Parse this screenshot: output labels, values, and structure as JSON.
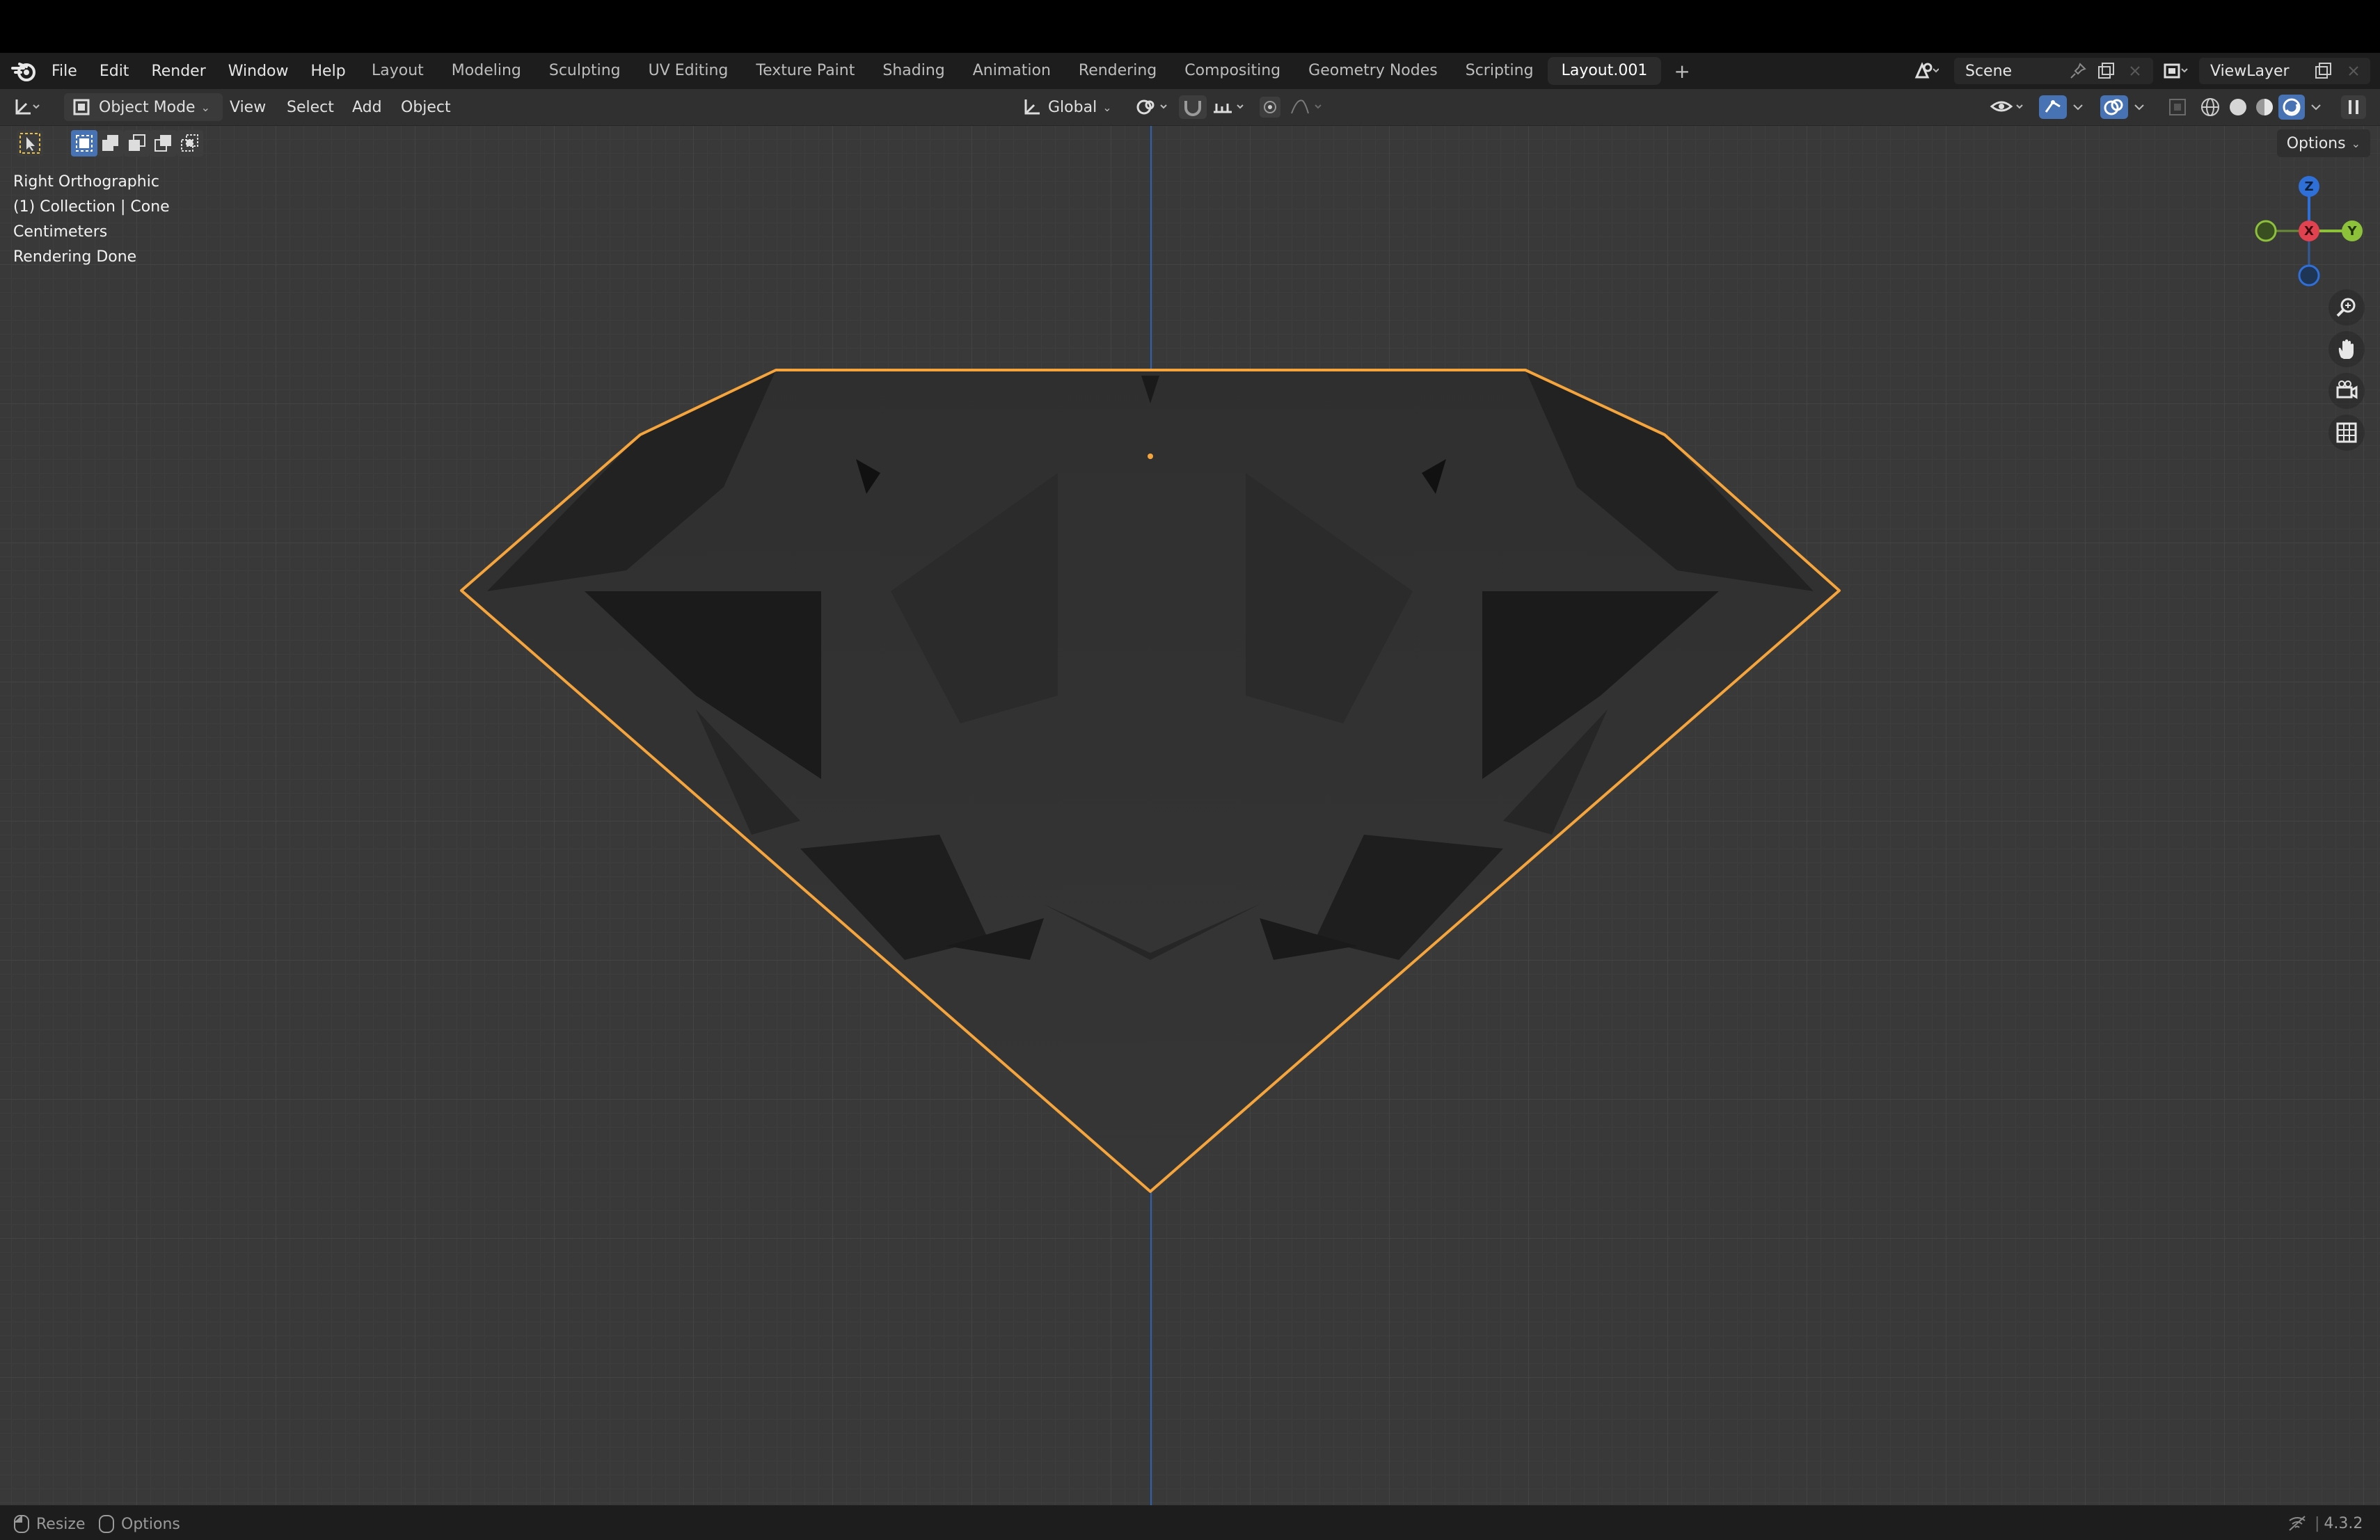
{
  "topbar": {
    "menus": [
      "File",
      "Edit",
      "Render",
      "Window",
      "Help"
    ],
    "workspaces": [
      "Layout",
      "Modeling",
      "Sculpting",
      "UV Editing",
      "Texture Paint",
      "Shading",
      "Animation",
      "Rendering",
      "Compositing",
      "Geometry Nodes",
      "Scripting",
      "Layout.001"
    ],
    "active_workspace": "Layout.001",
    "add_tab": "+",
    "scene": "Scene",
    "view_layer": "ViewLayer"
  },
  "header": {
    "mode": "Object Mode",
    "menus": [
      "View",
      "Select",
      "Add",
      "Object"
    ],
    "transform_orientation": "Global",
    "options": "Options"
  },
  "viewport": {
    "view_name": "Right Orthographic",
    "collection_info": "(1) Collection | Cone",
    "units": "Centimeters",
    "render_status": "Rendering Done",
    "gizmo_axes": {
      "z": "Z",
      "x": "X",
      "y": "Y"
    }
  },
  "statusbar": {
    "resize": "Resize",
    "options": "Options",
    "version": "4.3.2"
  },
  "colors": {
    "selection_outline": "#f5a53c",
    "axis_z": "#2f6fd8",
    "axis_x": "#e0424f",
    "axis_y": "#8dc13a"
  }
}
